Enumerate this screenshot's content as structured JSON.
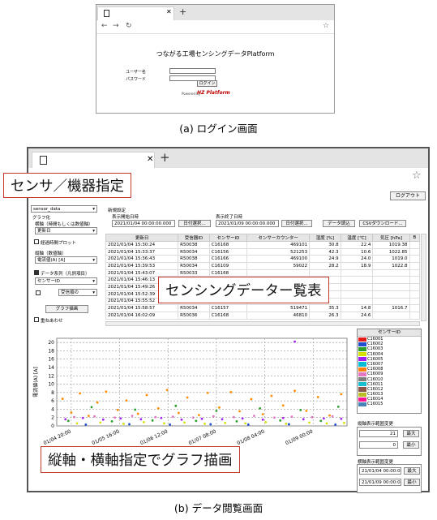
{
  "login": {
    "title": "つながる工場センシングデータPlatform",
    "user_label": "ユーザー名",
    "password_label": "パスワード",
    "login_button": "ログイン",
    "powered_by": "Powered by",
    "brand": "HZ Platform",
    "caption": "(a) ログイン画面"
  },
  "main": {
    "caption": "(b) データ閲覧画面",
    "logout": "ログアウト",
    "dataset_select": "sensor_data",
    "graph_group_label": "グラフ化",
    "mode_label": "横軸（時間もしくは数値軸）",
    "mode_value": "更新日",
    "connect_label": "経過時間プロット",
    "y_axis_label": "縦軸（数値軸）",
    "y_axis_value": "電流値(A) [A]",
    "series_label": "データ系列（凡例項目）",
    "series_value": "センサーID",
    "series_order": "受信順の",
    "draw_button": "グラフ描画",
    "overlay_label": "重ねあわせ",
    "new_setting": "新規設定",
    "start_label": "表示開始日時",
    "start_value": "2021/01/04 00:00:00.000",
    "end_label": "表示終了日時",
    "end_value": "2021/01/09 00:00:00.000",
    "date_select_1": "日付選択...",
    "date_select_2": "日付選択...",
    "load_button": "データ読込",
    "csv_button": "CSVダウンロード..."
  },
  "table": {
    "columns": [
      "更新日",
      "受信器ID",
      "センサーID",
      "センサーカウンター",
      "湿度 [%]",
      "温度 [℃]",
      "気圧 [hPa]",
      "B"
    ],
    "rows": [
      [
        "2021/01/04 15:30:24",
        "R50038",
        "C16168",
        "469101",
        "30.8",
        "22.4",
        "1019.38",
        ""
      ],
      [
        "2021/01/04 15:33:37",
        "R50034",
        "C16156",
        "521253",
        "42.3",
        "10.6",
        "1022.85",
        ""
      ],
      [
        "2021/01/04 15:36:43",
        "R50038",
        "C16166",
        "469100",
        "24.9",
        "24.0",
        "1019.0",
        ""
      ],
      [
        "2021/01/04 15:39:53",
        "R50034",
        "C16109",
        "59022",
        "28.2",
        "18.9",
        "1022.8",
        ""
      ],
      [
        "2021/01/04 15:43:07",
        "R50033",
        "C16168",
        "",
        "",
        "",
        "",
        ""
      ],
      [
        "2021/01/04 15:46:13",
        "",
        "",
        "",
        "",
        "",
        "",
        ""
      ],
      [
        "2021/01/04 15:49:26",
        "",
        "",
        "",
        "",
        "",
        "",
        ""
      ],
      [
        "2021/01/04 15:52:39",
        "",
        "",
        "",
        "",
        "",
        "",
        ""
      ],
      [
        "2021/01/04 15:55:52",
        "",
        "",
        "",
        "",
        "",
        "",
        ""
      ],
      [
        "2021/01/04 15:58:57",
        "R50034",
        "C16157",
        "519471",
        "35.3",
        "14.8",
        "1016.7",
        ""
      ],
      [
        "2021/01/04 16:02:09",
        "R50036",
        "C16168",
        "46810",
        "26.3",
        "24.6",
        "",
        ""
      ]
    ]
  },
  "callouts": {
    "sensor": "センサ／機器指定",
    "table": "センシングデーター覧表",
    "graph": "縦軸・横軸指定でグラフ描画"
  },
  "sensors": {
    "header": "センサーID",
    "items": [
      {
        "id": "C16001",
        "color": "#e41a1c"
      },
      {
        "id": "C16002",
        "color": "#1f4fcf"
      },
      {
        "id": "C16003",
        "color": "#2ca02c"
      },
      {
        "id": "C16004",
        "color": "#d4e000"
      },
      {
        "id": "C16005",
        "color": "#a020f0"
      },
      {
        "id": "C16007",
        "color": "#00bcd4"
      },
      {
        "id": "C16008",
        "color": "#ff7f0e"
      },
      {
        "id": "C16009",
        "color": "#e377c2"
      },
      {
        "id": "C16010",
        "color": "#7f7f7f"
      },
      {
        "id": "C16011",
        "color": "#17becf"
      },
      {
        "id": "C16012",
        "color": "#8c564b"
      },
      {
        "id": "C16013",
        "color": "#bcbd22"
      },
      {
        "id": "C16014",
        "color": "#ff1493"
      },
      {
        "id": "C16015",
        "color": "#4682b4"
      }
    ]
  },
  "y_range": {
    "label": "縦軸表示範囲変更",
    "max_value": "21",
    "min_value": "0",
    "max_button": "最大",
    "min_button": "最小"
  },
  "x_range": {
    "label": "横軸表示範囲変更",
    "start_value": "21/01/04 00:00:00",
    "end_value": "21/01/09 00:00:00",
    "max_button": "最大",
    "min_button": "最小"
  },
  "chart_data": {
    "type": "scatter",
    "ylabel": "電流値(A) [A]",
    "xlabel": "",
    "ylim": [
      0,
      21
    ],
    "yticks": [
      "0",
      "2",
      "4",
      "6",
      "8",
      "10",
      "12",
      "14",
      "16",
      "18",
      "20"
    ],
    "xticks": [
      "01/04 20:00",
      "01/05 16:00",
      "01/06 12:00",
      "01/07 08:00",
      "01/08 04:00",
      "01/09 00:00"
    ],
    "grid": true,
    "series": [
      {
        "color": "#ff8c00",
        "values": [
          [
            0.02,
            6.5
          ],
          [
            0.05,
            3.2
          ],
          [
            0.08,
            7.8
          ],
          [
            0.11,
            2.4
          ],
          [
            0.14,
            5.6
          ],
          [
            0.17,
            8.2
          ],
          [
            0.21,
            3.8
          ],
          [
            0.24,
            6.1
          ],
          [
            0.28,
            2.9
          ],
          [
            0.31,
            7.4
          ],
          [
            0.35,
            4.2
          ],
          [
            0.38,
            8.6
          ],
          [
            0.42,
            3.1
          ],
          [
            0.45,
            6.8
          ],
          [
            0.49,
            2.6
          ],
          [
            0.52,
            7.9
          ],
          [
            0.56,
            4.4
          ],
          [
            0.6,
            8.1
          ],
          [
            0.63,
            3.5
          ],
          [
            0.67,
            6.4
          ],
          [
            0.71,
            2.8
          ],
          [
            0.74,
            7.2
          ],
          [
            0.78,
            4.9
          ],
          [
            0.82,
            8.4
          ],
          [
            0.86,
            3.6
          ],
          [
            0.9,
            6.9
          ],
          [
            0.94,
            2.5
          ],
          [
            0.98,
            7.6
          ]
        ]
      },
      {
        "color": "#a020f0",
        "values": [
          [
            0.03,
            1.6
          ],
          [
            0.09,
            1.9
          ],
          [
            0.16,
            1.5
          ],
          [
            0.22,
            1.8
          ],
          [
            0.29,
            1.6
          ],
          [
            0.36,
            1.9
          ],
          [
            0.43,
            1.5
          ],
          [
            0.5,
            1.7
          ],
          [
            0.57,
            1.6
          ],
          [
            0.64,
            1.8
          ],
          [
            0.71,
            1.5
          ],
          [
            0.78,
            1.9
          ],
          [
            0.85,
            1.6
          ],
          [
            0.92,
            1.8
          ],
          [
            0.98,
            1.7
          ],
          [
            0.82,
            20.2
          ]
        ]
      },
      {
        "color": "#2ca02c",
        "values": [
          [
            0.04,
            1.2
          ],
          [
            0.12,
            4.5
          ],
          [
            0.19,
            1.1
          ],
          [
            0.27,
            3.9
          ],
          [
            0.33,
            1.3
          ],
          [
            0.41,
            4.8
          ],
          [
            0.48,
            1.2
          ],
          [
            0.55,
            3.6
          ],
          [
            0.62,
            1.1
          ],
          [
            0.7,
            4.2
          ],
          [
            0.77,
            1.3
          ],
          [
            0.84,
            3.8
          ],
          [
            0.91,
            1.2
          ],
          [
            0.97,
            4.6
          ]
        ]
      },
      {
        "color": "#e377c2",
        "values": [
          [
            0.06,
            2.1
          ],
          [
            0.13,
            2.3
          ],
          [
            0.2,
            2.0
          ],
          [
            0.26,
            2.4
          ],
          [
            0.34,
            2.1
          ],
          [
            0.4,
            2.2
          ],
          [
            0.47,
            2.0
          ],
          [
            0.54,
            2.3
          ],
          [
            0.61,
            2.1
          ],
          [
            0.68,
            2.4
          ],
          [
            0.75,
            2.0
          ],
          [
            0.81,
            2.2
          ],
          [
            0.88,
            2.1
          ],
          [
            0.95,
            2.3
          ]
        ]
      },
      {
        "color": "#d4e000",
        "values": [
          [
            0.07,
            0.6
          ],
          [
            0.15,
            0.8
          ],
          [
            0.23,
            0.5
          ],
          [
            0.3,
            0.9
          ],
          [
            0.37,
            0.6
          ],
          [
            0.44,
            0.8
          ],
          [
            0.51,
            0.5
          ],
          [
            0.58,
            0.7
          ],
          [
            0.65,
            0.6
          ],
          [
            0.72,
            0.9
          ],
          [
            0.79,
            0.5
          ],
          [
            0.87,
            0.8
          ],
          [
            0.93,
            0.6
          ],
          [
            0.99,
            0.7
          ]
        ]
      },
      {
        "color": "#1f4fcf",
        "values": [
          [
            0.1,
            0.3
          ],
          [
            0.25,
            0.4
          ],
          [
            0.39,
            0.3
          ],
          [
            0.53,
            0.4
          ],
          [
            0.66,
            0.3
          ],
          [
            0.8,
            0.4
          ],
          [
            0.96,
            0.3
          ]
        ]
      }
    ]
  }
}
